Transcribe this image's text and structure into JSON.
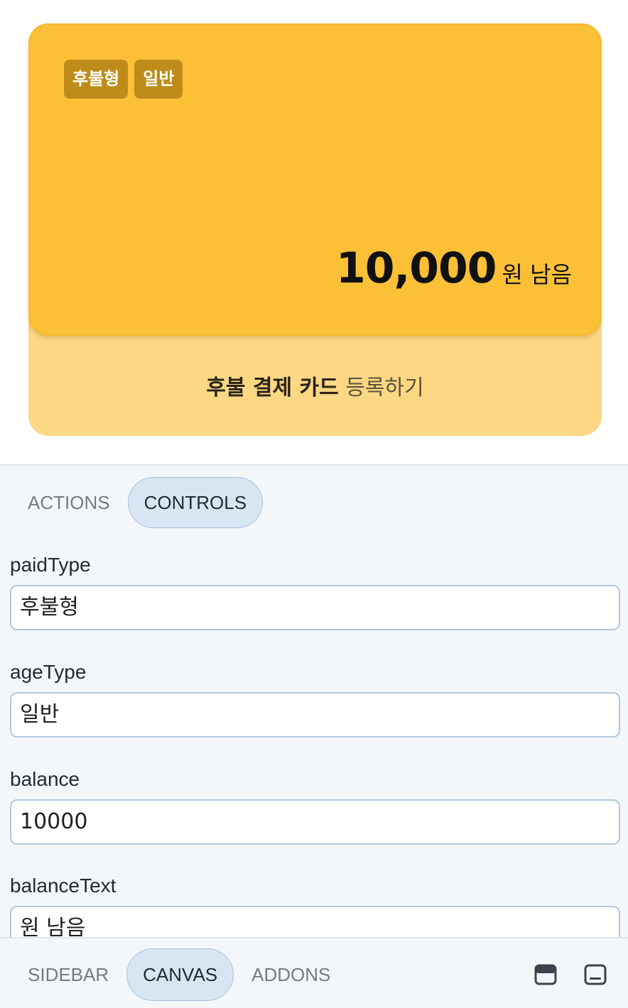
{
  "card": {
    "badges": [
      "후불형",
      "일반"
    ],
    "balance_value": "10,000",
    "balance_text": "원 남음",
    "register_bold": "후불 결제 카드",
    "register_rest": "등록하기",
    "colors": {
      "card": "#fbc036",
      "card_bg": "#fcd784",
      "badge": "#bf8c1b"
    }
  },
  "panel": {
    "tabs": [
      {
        "label": "ACTIONS",
        "active": false
      },
      {
        "label": "CONTROLS",
        "active": true
      }
    ],
    "fields": [
      {
        "label": "paidType",
        "value": "후불형"
      },
      {
        "label": "ageType",
        "value": "일반"
      },
      {
        "label": "balance",
        "value": "10000"
      },
      {
        "label": "balanceText",
        "value": "원 남음"
      }
    ]
  },
  "bottombar": {
    "tabs": [
      {
        "label": "SIDEBAR",
        "active": false
      },
      {
        "label": "CANVAS",
        "active": true
      },
      {
        "label": "ADDONS",
        "active": false
      }
    ],
    "icons": [
      "panel-top-icon",
      "panel-bottom-icon"
    ]
  }
}
